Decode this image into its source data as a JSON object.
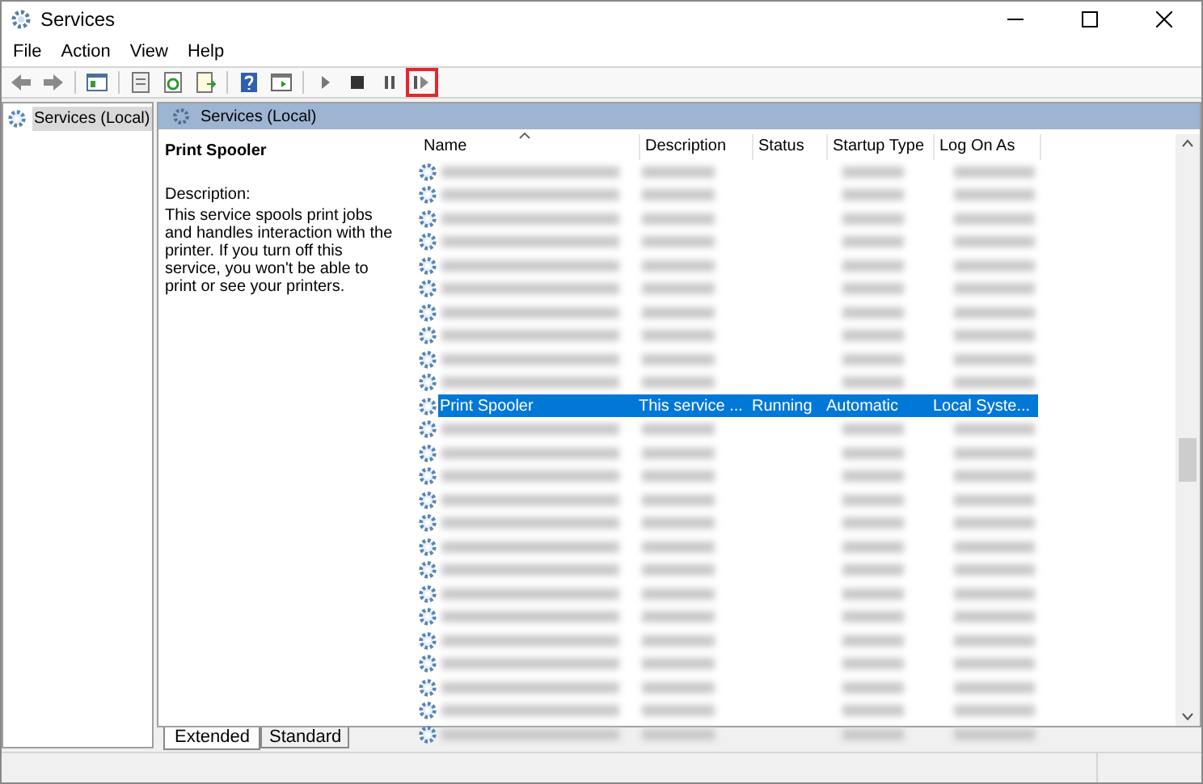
{
  "window": {
    "title": "Services"
  },
  "menu": [
    "File",
    "Action",
    "View",
    "Help"
  ],
  "toolbar": [
    {
      "kind": "back",
      "highlighted": false
    },
    {
      "kind": "forward",
      "highlighted": false
    },
    {
      "kind": "sep"
    },
    {
      "kind": "console",
      "highlighted": false
    },
    {
      "kind": "sep"
    },
    {
      "kind": "properties",
      "highlighted": false
    },
    {
      "kind": "refresh",
      "highlighted": false
    },
    {
      "kind": "export",
      "highlighted": false
    },
    {
      "kind": "sep"
    },
    {
      "kind": "help",
      "highlighted": false
    },
    {
      "kind": "view",
      "highlighted": false
    },
    {
      "kind": "sep"
    },
    {
      "kind": "start",
      "highlighted": false
    },
    {
      "kind": "stop",
      "highlighted": false
    },
    {
      "kind": "pause",
      "highlighted": false
    },
    {
      "kind": "resume",
      "highlighted": true
    }
  ],
  "tree": [
    {
      "label": "Services (Local)",
      "selected": true
    }
  ],
  "pane_header": "Services (Local)",
  "details": {
    "title": "Print Spooler",
    "description_label": "Description:",
    "description": "This service spools print jobs and handles interaction with the printer. If you turn off this service, you won't be able to print or see your printers."
  },
  "table": {
    "columns": [
      "Name",
      "Description",
      "Status",
      "Startup Type",
      "Log On As"
    ],
    "rows": [
      {
        "kind": "blurred"
      },
      {
        "kind": "blurred"
      },
      {
        "kind": "blurred"
      },
      {
        "kind": "blurred"
      },
      {
        "kind": "blurred"
      },
      {
        "kind": "blurred"
      },
      {
        "kind": "blurred"
      },
      {
        "kind": "blurred"
      },
      {
        "kind": "blurred"
      },
      {
        "kind": "blurred"
      },
      {
        "kind": "service",
        "selected": true,
        "cells": [
          "Print Spooler",
          "This service ...",
          "Running",
          "Automatic",
          "Local Syste..."
        ]
      },
      {
        "kind": "blurred"
      },
      {
        "kind": "blurred"
      },
      {
        "kind": "blurred"
      },
      {
        "kind": "blurred"
      },
      {
        "kind": "blurred"
      },
      {
        "kind": "blurred"
      },
      {
        "kind": "blurred"
      },
      {
        "kind": "blurred"
      },
      {
        "kind": "blurred"
      },
      {
        "kind": "blurred"
      },
      {
        "kind": "blurred"
      },
      {
        "kind": "blurred"
      },
      {
        "kind": "blurred"
      },
      {
        "kind": "blurred"
      }
    ]
  },
  "tabs": [
    {
      "label": "Extended",
      "selected": true
    },
    {
      "label": "Standard",
      "selected": false
    }
  ]
}
